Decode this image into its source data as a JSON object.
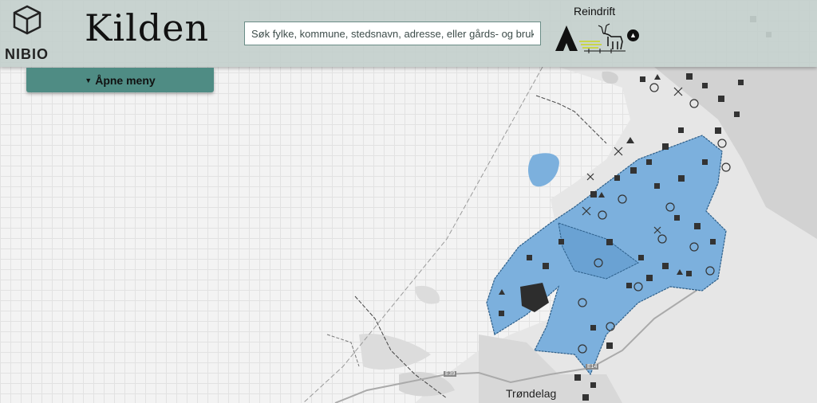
{
  "app": {
    "title": "Kilden",
    "org": "NIBIO"
  },
  "search": {
    "placeholder": "Søk fylke, kommune, stedsnavn, adresse, eller gårds- og bruksnum"
  },
  "theme": {
    "label": "Reindrift",
    "icon": "reindrift-theme-icon",
    "collapse_icon": "chevron-up-icon"
  },
  "menu": {
    "label": "Åpne meny",
    "icon": "caret-down-icon"
  },
  "map": {
    "place_label": "Trøndelag",
    "roads": [
      "E39",
      "E14"
    ],
    "colors": {
      "area_fill": "#7cb0dd",
      "area_stroke": "#2d5f8a",
      "land": "#e8e8e8",
      "grid": "#e2e2e2"
    }
  }
}
